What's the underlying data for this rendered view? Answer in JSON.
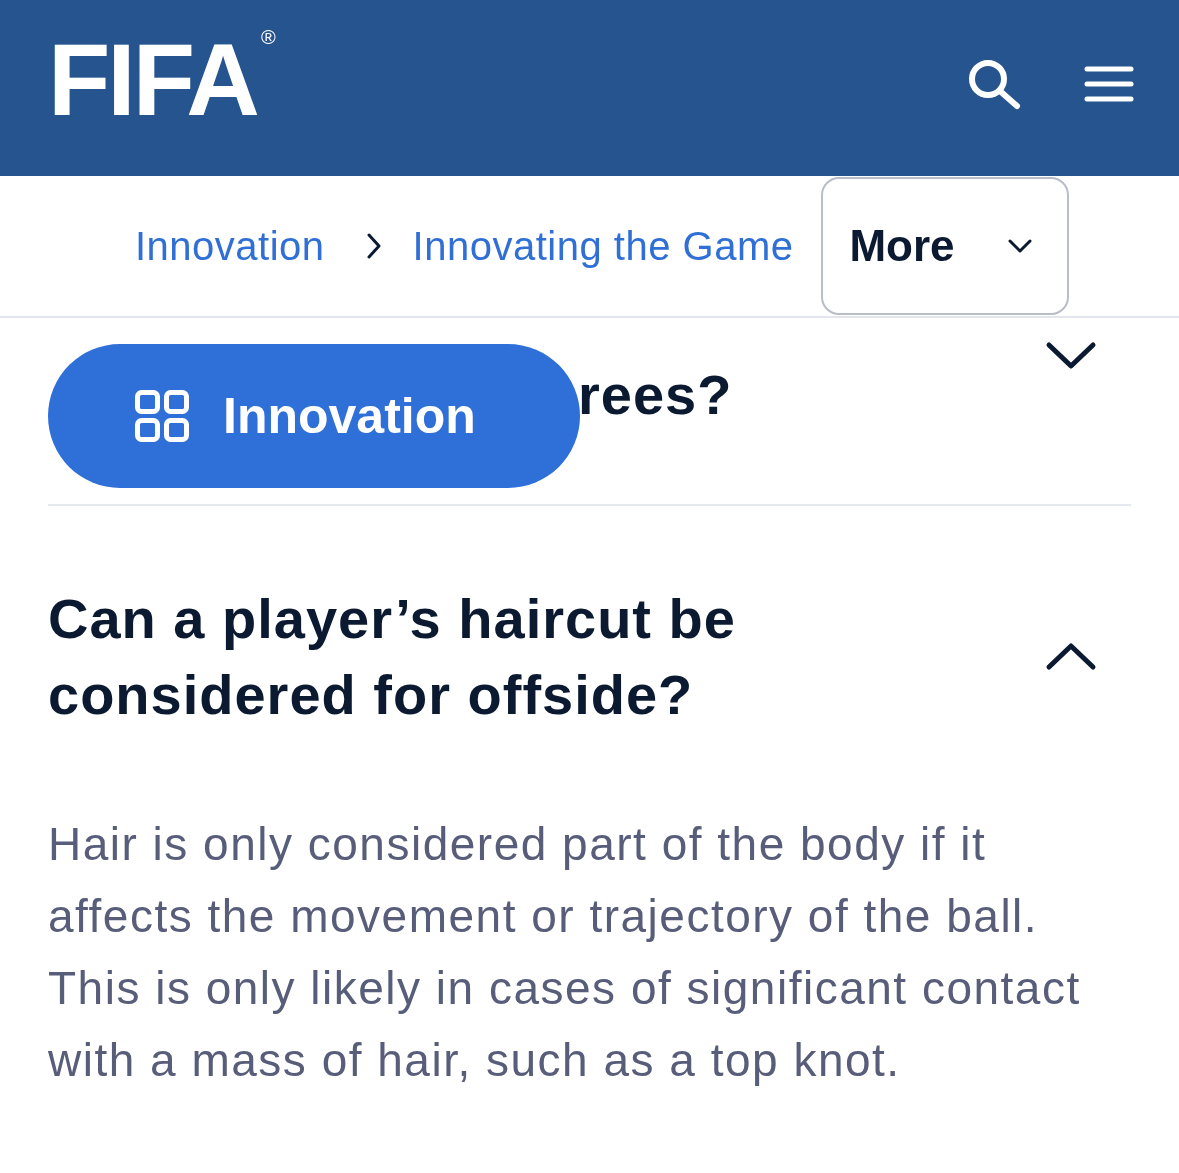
{
  "header": {
    "logo": {
      "text": "FIFA",
      "mark": "®"
    }
  },
  "breadcrumb": {
    "items": [
      {
        "label": "Innovation"
      },
      {
        "label": "Innovating the Game"
      }
    ],
    "more": {
      "label": "More"
    }
  },
  "floating_button": {
    "label": "Innovation"
  },
  "faq": [
    {
      "question": "rees?",
      "expanded": false
    },
    {
      "question": "Can a player’s haircut be considered for offside?",
      "expanded": true,
      "answer": "Hair is only considered part of the body if it affects the movement or trajectory of the ball. This is only likely in cases of significant contact with a mass of hair, such as a top knot."
    }
  ]
}
